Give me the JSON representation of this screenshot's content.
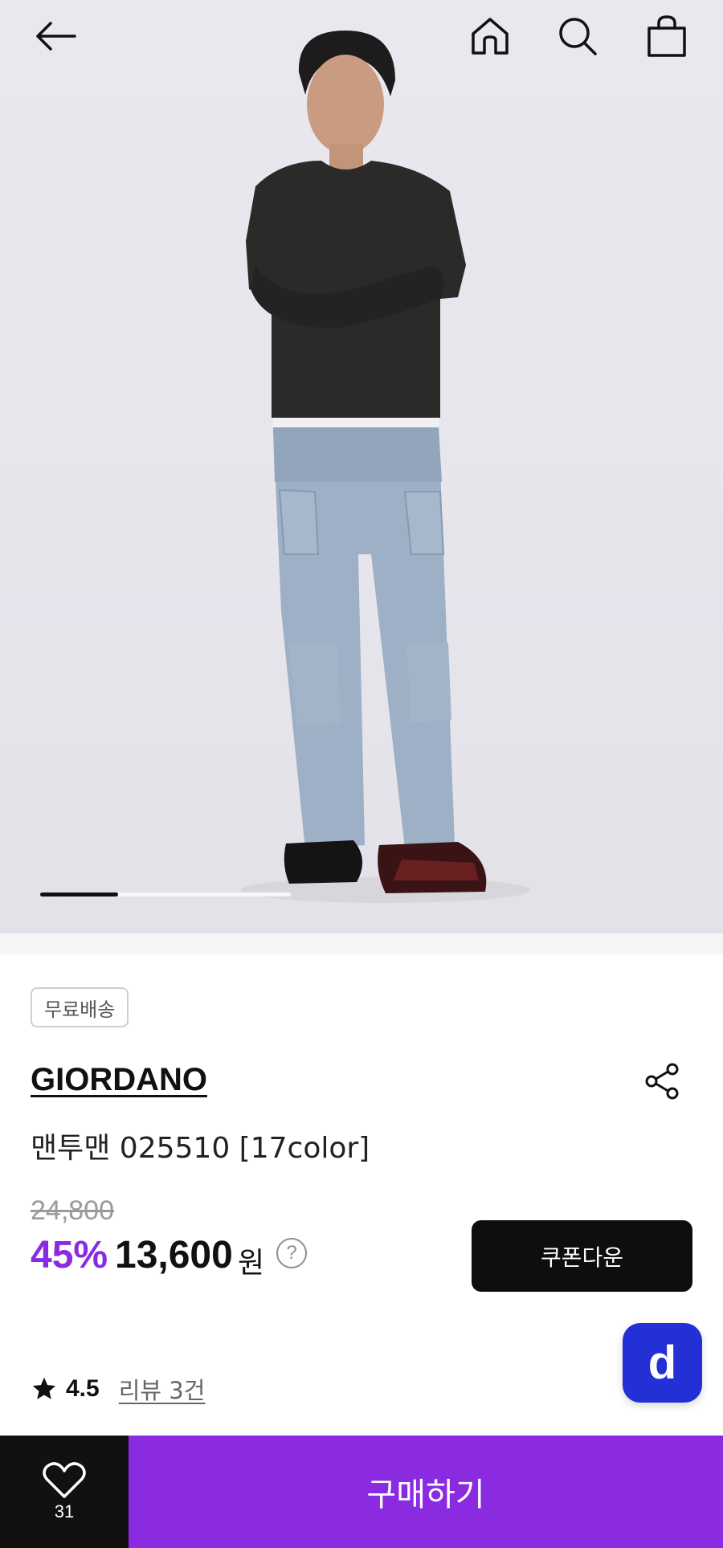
{
  "colors": {
    "accent_purple": "#8a2be2",
    "fab_blue": "#2230d6",
    "dark": "#111111",
    "muted_text": "#9a9a9a"
  },
  "header": {
    "back_icon": "back-arrow-icon",
    "home_icon": "home-icon",
    "search_icon": "search-icon",
    "cart_icon": "shopping-bag-icon"
  },
  "gallery": {
    "progress_fraction": 0.31
  },
  "product": {
    "badge": "무료배송",
    "brand": "GIORDANO",
    "name": "맨투맨 025510 [17color]",
    "original_price": "24,800",
    "discount": "45%",
    "price": "13,600",
    "currency": "원",
    "help_icon_text": "?",
    "coupon_button": "쿠폰다운"
  },
  "fab": {
    "label": "d"
  },
  "rating": {
    "value": "4.5",
    "review_link": "리뷰 3건"
  },
  "bottom_bar": {
    "like_count": "31",
    "buy_button": "구매하기"
  }
}
